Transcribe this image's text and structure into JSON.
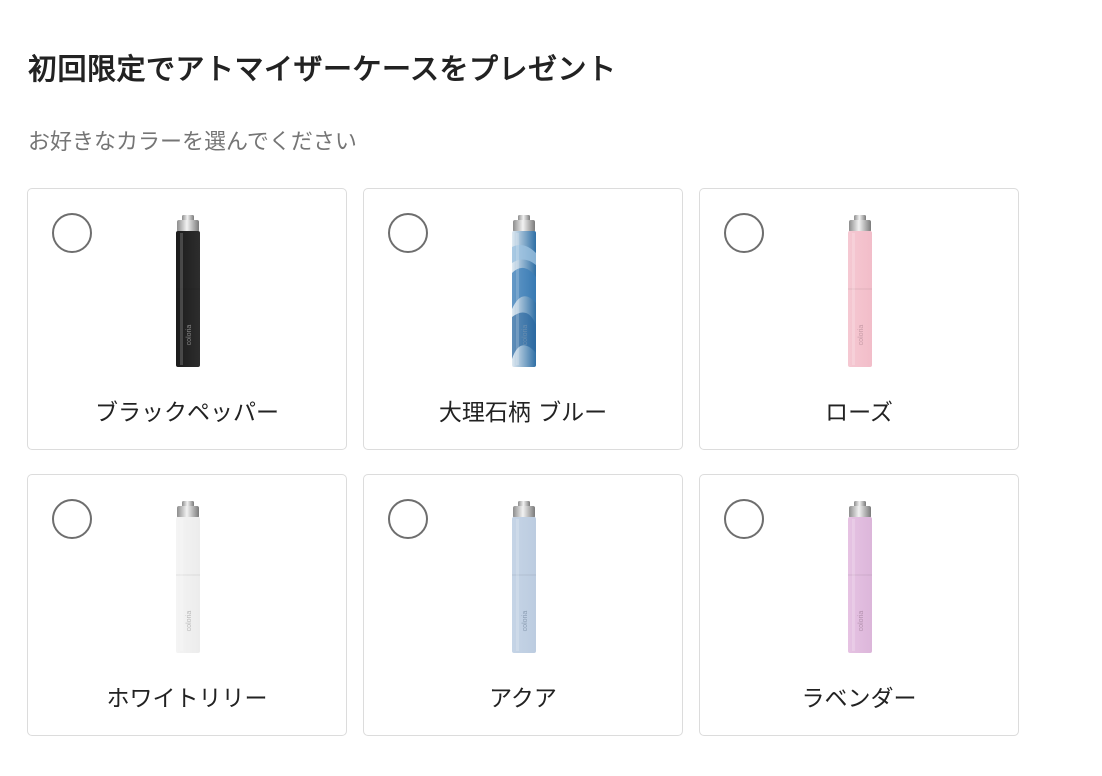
{
  "header": {
    "title": "初回限定でアトマイザーケースをプレゼント",
    "subtitle": "お好きなカラーを選んでください"
  },
  "options": [
    {
      "label": "ブラックペッパー",
      "brand": "coloria",
      "color": "#1c1c1c",
      "color_end": "#2d2d2d",
      "pattern": "solid",
      "text_color": "#8a8a8a"
    },
    {
      "label": "大理石柄 ブルー",
      "brand": "coloria",
      "color": "#dfeaf2",
      "color_end": "#2f6fa5",
      "pattern": "marble",
      "text_color": "#6b8fb0"
    },
    {
      "label": "ローズ",
      "brand": "coloria",
      "color": "#f5c8d2",
      "color_end": "#f2bdc9",
      "pattern": "solid",
      "text_color": "#c79aa6"
    },
    {
      "label": "ホワイトリリー",
      "brand": "coloria",
      "color": "#f4f4f4",
      "color_end": "#ececec",
      "pattern": "solid",
      "text_color": "#b8b8b8"
    },
    {
      "label": "アクア",
      "brand": "coloria",
      "color": "#c5d4e6",
      "color_end": "#bccce0",
      "pattern": "solid",
      "text_color": "#8a9cb2"
    },
    {
      "label": "ラベンダー",
      "brand": "coloria",
      "color": "#e6c3e3",
      "color_end": "#dcb6da",
      "pattern": "solid",
      "text_color": "#b290ad"
    }
  ]
}
